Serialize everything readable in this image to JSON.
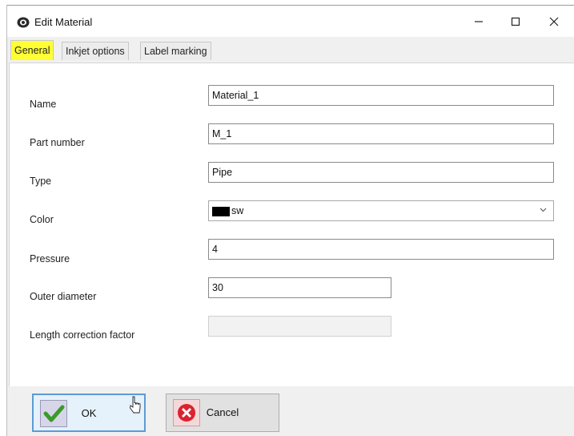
{
  "window": {
    "title": "Edit Material",
    "icon": "gear-app-icon",
    "controls": {
      "minimize": "—",
      "maximize": "☐",
      "close": "✕"
    }
  },
  "tabs": [
    {
      "label": "General",
      "active": true
    },
    {
      "label": "Inkjet options",
      "active": false
    },
    {
      "label": "Label marking",
      "active": false
    }
  ],
  "form": {
    "name": {
      "label": "Name",
      "value": "Material_1"
    },
    "part_number": {
      "label": "Part number",
      "value": "M_1"
    },
    "type": {
      "label": "Type",
      "value": "Pipe"
    },
    "color": {
      "label": "Color",
      "value": "sw",
      "swatch": "#000000"
    },
    "pressure": {
      "label": "Pressure",
      "value": "4"
    },
    "outer_diameter": {
      "label": "Outer diameter",
      "value": "30"
    },
    "length_correction_factor": {
      "label": "Length correction factor",
      "value": ""
    }
  },
  "buttons": {
    "ok": "OK",
    "cancel": "Cancel"
  },
  "colors": {
    "active_tab_highlight": "#ffff33",
    "default_button_border": "#5b9bd5",
    "ok_check": "#3c9a2a",
    "cancel_icon": "#d9232f"
  }
}
